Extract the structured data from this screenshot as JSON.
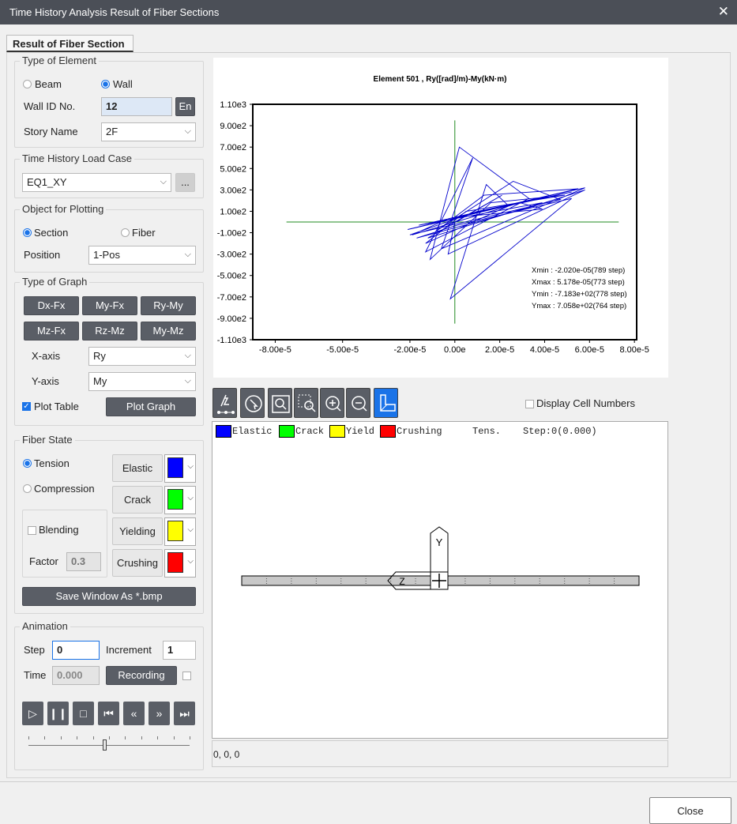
{
  "window": {
    "title": "Time History Analysis Result of Fiber Sections",
    "close_icon": "close-icon"
  },
  "tab": {
    "label": "Result of Fiber Section"
  },
  "type_of_element": {
    "label": "Type of Element",
    "beam_label": "Beam",
    "wall_label": "Wall",
    "selected": "Wall",
    "wall_id_label": "Wall ID No.",
    "wall_id_value": "12",
    "en_button": "En",
    "story_label": "Story Name",
    "story_value": "2F"
  },
  "load_case": {
    "label": "Time History Load Case",
    "value": "EQ1_XY",
    "more_button": "..."
  },
  "object_plotting": {
    "label": "Object for Plotting",
    "section_label": "Section",
    "fiber_label": "Fiber",
    "selected": "Section",
    "position_label": "Position",
    "position_value": "1-Pos"
  },
  "type_of_graph": {
    "label": "Type of Graph",
    "buttons": [
      "Dx-Fx",
      "My-Fx",
      "Ry-My",
      "Mz-Fx",
      "Rz-Mz",
      "My-Mz"
    ],
    "xaxis_label": "X-axis",
    "xaxis_value": "Ry",
    "yaxis_label": "Y-axis",
    "yaxis_value": "My",
    "plot_table_label": "Plot Table",
    "plot_table_checked": true,
    "plot_graph_button": "Plot Graph"
  },
  "fiber_state": {
    "label": "Fiber State",
    "tension_label": "Tension",
    "compression_label": "Compression",
    "selected": "Tension",
    "blending_label": "Blending",
    "factor_label": "Factor",
    "factor_value": "0.3",
    "states": [
      {
        "label": "Elastic",
        "color": "#0000ff"
      },
      {
        "label": "Crack",
        "color": "#00ff00"
      },
      {
        "label": "Yielding",
        "color": "#ffff00"
      },
      {
        "label": "Crushing",
        "color": "#ff0000"
      }
    ],
    "save_button": "Save Window As *.bmp"
  },
  "animation": {
    "label": "Animation",
    "step_label": "Step",
    "step_value": "0",
    "increment_label": "Increment",
    "increment_value": "1",
    "time_label": "Time",
    "time_value": "0.000",
    "recording_button": "Recording",
    "slider_fraction": 0.47,
    "controls": [
      "play-icon",
      "pause-icon",
      "stop-icon",
      "skip-to-start-icon",
      "rewind-icon",
      "fast-forward-icon",
      "skip-to-end-icon"
    ]
  },
  "chart_data": {
    "type": "line",
    "title": "Element 501 , Ry([rad]/m)-My(kN·m)",
    "xlabel": "",
    "ylabel": "",
    "x_ticks": [
      "-8.00e-5",
      "-5.00e-5",
      "-2.00e-5",
      "0.00e",
      "2.00e-5",
      "4.00e-5",
      "6.00e-5",
      "8.00e-5"
    ],
    "x_tick_values": [
      -8e-05,
      -5e-05,
      -2e-05,
      0,
      2e-05,
      4e-05,
      6e-05,
      8e-05
    ],
    "y_ticks": [
      "1.10e3",
      "9.00e2",
      "7.00e2",
      "5.00e2",
      "3.00e2",
      "1.00e2",
      "-1.00e2",
      "-3.00e2",
      "-5.00e2",
      "-7.00e2",
      "-9.00e2",
      "-1.10e3"
    ],
    "y_tick_values": [
      1100,
      900,
      700,
      500,
      300,
      100,
      -100,
      -300,
      -500,
      -700,
      -900,
      -1100
    ],
    "xlim": [
      -9e-05,
      8.1e-05
    ],
    "ylim": [
      -1100,
      1100
    ],
    "annotations": [
      "Xmin : -2.020e-05(789 step)",
      "Xmax : 5.178e-05(773 step)",
      "Ymin : -7.183e+02(778 step)",
      "Ymax : 7.058e+02(764 step)"
    ],
    "axis_lines": {
      "x_range": [
        -7.5e-05,
        7.3e-05
      ],
      "y_range": [
        -950,
        950
      ],
      "color": "#228b22"
    },
    "series": [
      {
        "color": "#0000cc",
        "x": [
          0,
          2.1e-05,
          -1.2e-05,
          3.9e-05,
          -1.6e-05,
          5.2e-05,
          1e-05,
          -2e-05,
          4.7e-05,
          2.6e-05,
          -8e-06,
          1.3e-05,
          5.5e-05,
          -3e-06,
          -1.9e-05,
          2.9e-05,
          3.9e-05,
          4e-06,
          -2.1e-05,
          4.3e-05,
          5.8e-05,
          -6e-06,
          8e-06,
          -1.3e-05,
          3.3e-05,
          2e-06,
          -1.1e-05,
          1.6e-05,
          4.9e-05,
          5e-06,
          -1.3e-05,
          2.4e-05,
          1.4e-05,
          -2e-06,
          5.2e-05,
          1e-06,
          -1.7e-05,
          3.1e-05,
          5.8e-05,
          -3e-06,
          0
        ],
        "y": [
          0,
          250,
          -150,
          180,
          -30,
          280,
          100,
          -120,
          210,
          380,
          -80,
          250,
          310,
          30,
          -120,
          180,
          120,
          50,
          -70,
          250,
          320,
          -250,
          600,
          -280,
          220,
          700,
          -350,
          180,
          250,
          100,
          -200,
          150,
          350,
          -718,
          220,
          -30,
          -150,
          120,
          300,
          -300,
          0
        ]
      }
    ]
  },
  "fiber_view": {
    "toolbar_icons": [
      "pointer-icon",
      "select-icon",
      "zoom-window-icon",
      "zoom-region-icon",
      "zoom-in-icon",
      "zoom-out-icon",
      "section-view-icon"
    ],
    "display_cell_numbers_label": "Display Cell Numbers",
    "legend": [
      {
        "label": "Elastic",
        "color": "#0000ff"
      },
      {
        "label": "Crack",
        "color": "#00ff00"
      },
      {
        "label": "Yield",
        "color": "#ffff00"
      },
      {
        "label": "Crushing",
        "color": "#ff0000"
      }
    ],
    "tens_label": "Tens.",
    "step_text": "Step:0(0.000)",
    "axis_y_label": "Y",
    "axis_z_label": "Z",
    "status_text": "0, 0, 0"
  },
  "footer": {
    "close_button": "Close"
  }
}
